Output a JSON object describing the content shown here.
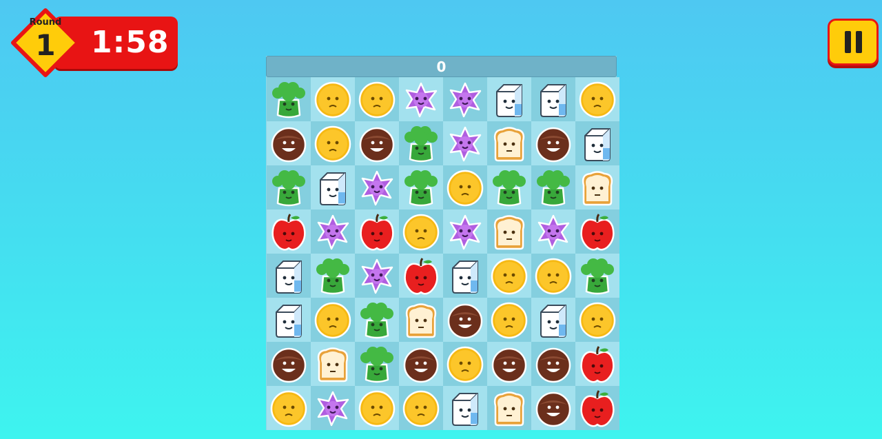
{
  "hud": {
    "round_label": "Round",
    "round_number": "1",
    "timer": "1:58",
    "pause_icon": "pause-icon"
  },
  "score": "0",
  "colors": {
    "timer_bg": "#e81414",
    "badge": "#ffcc0a",
    "board_bg": "#8fd7e6",
    "score_bar": "#6fb2c8"
  },
  "piece_types": [
    "broccoli",
    "orange",
    "flower",
    "milk",
    "coconut",
    "bread",
    "apple"
  ],
  "board": [
    [
      "broccoli",
      "orange",
      "orange",
      "flower",
      "flower",
      "milk",
      "milk",
      "orange"
    ],
    [
      "coconut",
      "orange",
      "coconut",
      "broccoli",
      "flower",
      "bread",
      "coconut",
      "milk"
    ],
    [
      "broccoli",
      "milk",
      "flower",
      "broccoli",
      "orange",
      "broccoli",
      "broccoli",
      "bread"
    ],
    [
      "apple",
      "flower",
      "apple",
      "orange",
      "flower",
      "bread",
      "flower",
      "apple"
    ],
    [
      "milk",
      "broccoli",
      "flower",
      "apple",
      "milk",
      "orange",
      "orange",
      "broccoli"
    ],
    [
      "milk",
      "orange",
      "broccoli",
      "bread",
      "coconut",
      "orange",
      "milk",
      "orange"
    ],
    [
      "coconut",
      "bread",
      "broccoli",
      "coconut",
      "orange",
      "coconut",
      "coconut",
      "apple"
    ],
    [
      "orange",
      "flower",
      "orange",
      "orange",
      "milk",
      "bread",
      "coconut",
      "apple"
    ]
  ]
}
